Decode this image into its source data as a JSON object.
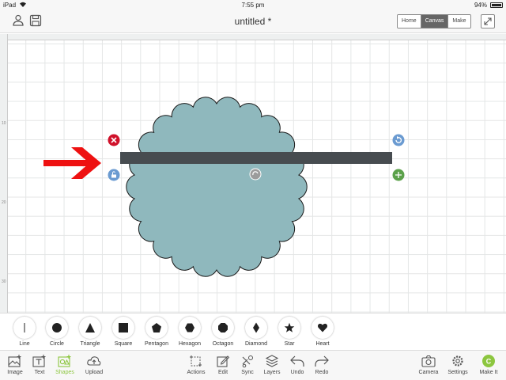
{
  "status_bar": {
    "carrier": "iPad",
    "time": "7:55 pm",
    "battery": "94%"
  },
  "header": {
    "title": "untitled *"
  },
  "view_tabs": [
    {
      "label": "Home",
      "active": false
    },
    {
      "label": "Canvas",
      "active": true
    },
    {
      "label": "Make",
      "active": false
    }
  ],
  "rulers": {
    "left": [
      "10",
      "20",
      "30"
    ]
  },
  "shapes": [
    {
      "label": "Line",
      "icon": "line-icon"
    },
    {
      "label": "Circle",
      "icon": "circle-icon"
    },
    {
      "label": "Triangle",
      "icon": "triangle-icon"
    },
    {
      "label": "Square",
      "icon": "square-icon"
    },
    {
      "label": "Pentagon",
      "icon": "pentagon-icon"
    },
    {
      "label": "Hexagon",
      "icon": "hexagon-icon"
    },
    {
      "label": "Octagon",
      "icon": "octagon-icon"
    },
    {
      "label": "Diamond",
      "icon": "diamond-icon"
    },
    {
      "label": "Star",
      "icon": "star-icon"
    },
    {
      "label": "Heart",
      "icon": "heart-icon"
    }
  ],
  "toolbar": {
    "image": "Image",
    "text": "Text",
    "shapes": "Shapes",
    "upload": "Upload",
    "actions": "Actions",
    "edit": "Edit",
    "sync": "Sync",
    "layers": "Layers",
    "undo": "Undo",
    "redo": "Redo",
    "camera": "Camera",
    "settings": "Settings",
    "make_it": "Make It",
    "make_it_badge": "C",
    "active_tool": "shapes"
  },
  "colors": {
    "scallop_fill": "#8fb8bd",
    "bar_fill": "#474c50",
    "arrow": "#ee1111",
    "accent_green": "#8cc63f",
    "handle_delete": "#d0122b",
    "handle_blue": "#6b9bd1",
    "handle_scale": "#5ba14a"
  }
}
